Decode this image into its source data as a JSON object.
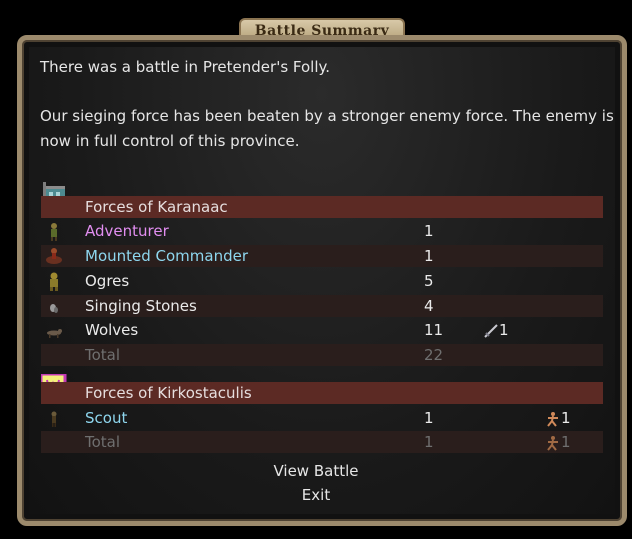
{
  "dialog": {
    "title": "Battle Summary",
    "message_line1": "There was a battle in Pretender's Folly.",
    "message_line2a": "Our sieging force has been beaten by a stronger enemy force. The enemy is",
    "message_line2b": "now in full control of this province."
  },
  "side1": {
    "header": "Forces of Karanaac",
    "units": [
      {
        "name": "Adventurer",
        "count": "1",
        "icon": "adventurer-icon"
      },
      {
        "name": "Mounted Commander",
        "count": "1",
        "icon": "mounted-commander-icon"
      },
      {
        "name": "Ogres",
        "count": "5",
        "icon": "ogre-icon"
      },
      {
        "name": "Singing Stones",
        "count": "4",
        "icon": "stone-icon"
      },
      {
        "name": "Wolves",
        "count": "11",
        "killed": "1",
        "icon": "wolf-icon"
      }
    ],
    "total_label": "Total",
    "total": "22"
  },
  "side2": {
    "header": "Forces of Kirkostaculis",
    "units": [
      {
        "name": "Scout",
        "count": "1",
        "fled": "1",
        "icon": "scout-icon"
      }
    ],
    "total_label": "Total",
    "total": "1",
    "total_fled": "1"
  },
  "actions": {
    "view_battle": "View Battle",
    "exit": "Exit"
  },
  "colors": {
    "commander_purple": "#e18ef0",
    "commander_cyan": "#8ed6ee",
    "header_row": "#5c2a24"
  }
}
